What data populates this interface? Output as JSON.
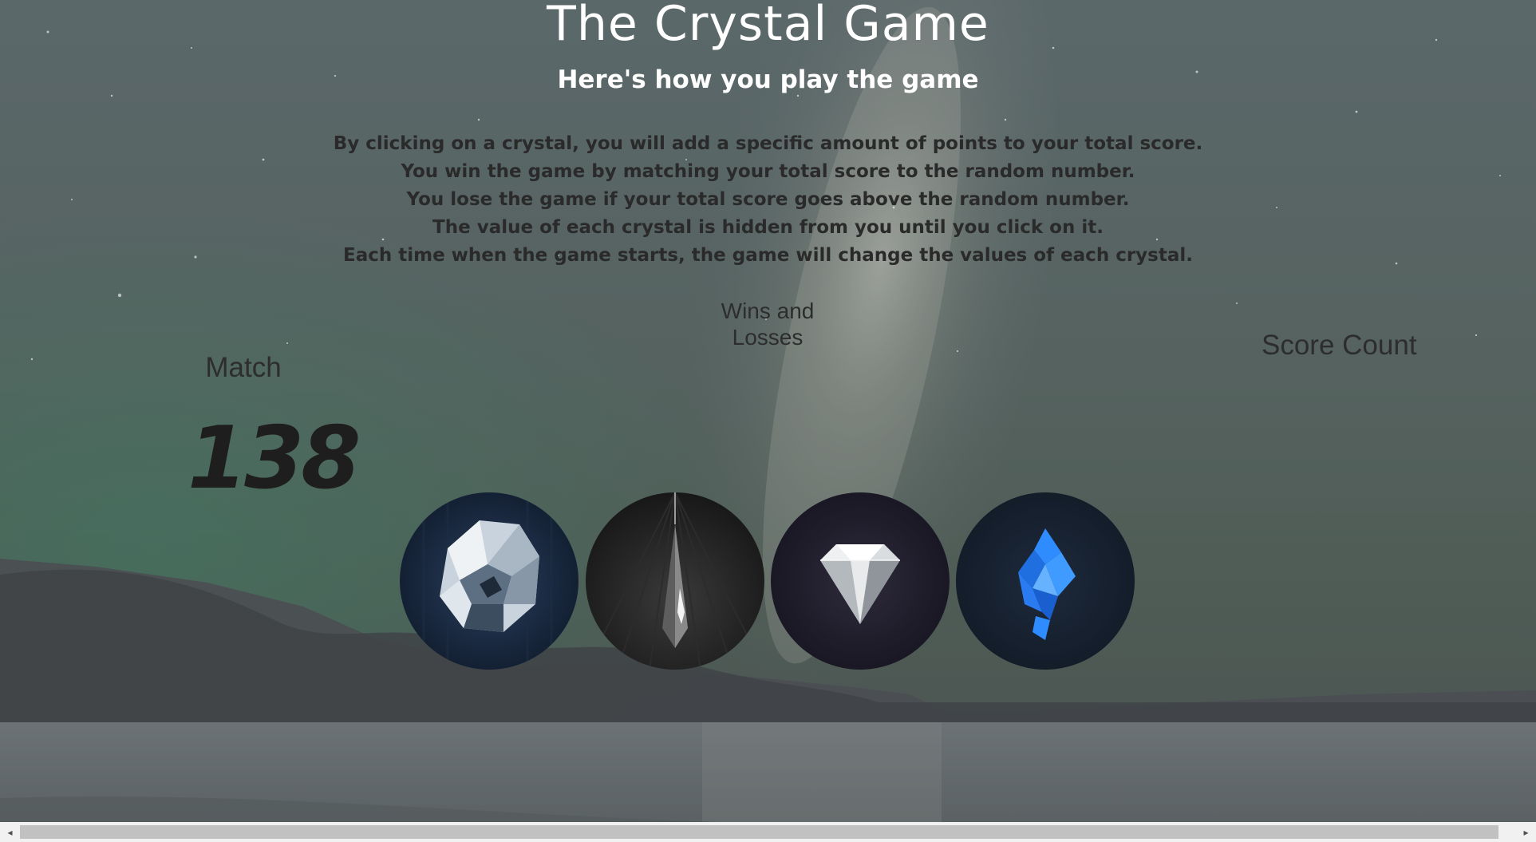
{
  "header": {
    "title": "The Crystal Game",
    "subtitle": "Here's how you play the game"
  },
  "rules": [
    "By clicking on a crystal, you will add a specific amount of points to your total score.",
    "You win the game by matching your total score to the random number.",
    "You lose the game if your total score goes above the random number.",
    "The value of each crystal is hidden from you until you click on it.",
    "Each time when the game starts, the game will change the values of each crystal."
  ],
  "scoreboard": {
    "wins_label": "Wins and Losses",
    "wins_value": "",
    "match_label": "Match",
    "match_value": "138",
    "score_label": "Score Count",
    "score_value": ""
  },
  "crystals": [
    {
      "name": "round-faceted-crystal",
      "icon": "crystal-ball-icon"
    },
    {
      "name": "pendant-crystal",
      "icon": "crystal-pendant-icon"
    },
    {
      "name": "diamond-crystal",
      "icon": "diamond-icon"
    },
    {
      "name": "blue-shard-crystal",
      "icon": "blue-crystal-icon"
    }
  ],
  "scrollbar": {
    "left_arrow": "◂",
    "right_arrow": "▸",
    "thumb_fraction": 0.97
  },
  "colors": {
    "title": "#ffffff",
    "rules_text": "#2a2a2a",
    "scrollbar_track": "#f1f1f1",
    "scrollbar_thumb": "#c1c1c1"
  }
}
